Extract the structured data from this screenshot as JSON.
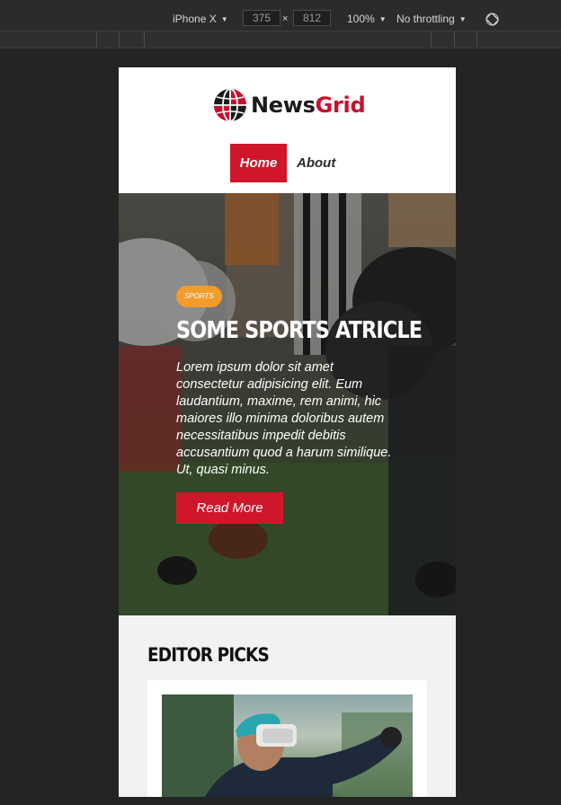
{
  "devtools": {
    "device": "iPhone X",
    "width": "375",
    "times": "×",
    "height": "812",
    "zoom": "100%",
    "throttle": "No throttling",
    "dropdown_caret": "▼"
  },
  "site": {
    "logo": {
      "news": "News",
      "grid": "Grid"
    },
    "nav": [
      {
        "label": "Home",
        "active": true
      },
      {
        "label": "About",
        "active": false
      }
    ],
    "hero": {
      "badge": "SPORTS",
      "title": "SOME SPORTS ATRICLE",
      "text": "Lorem ipsum dolor sit amet consectetur adipisicing elit. Eum laudantium, maxime, rem animi, hic maiores illo minima doloribus autem necessitatibus impedit debitis accusantium quod a harum similique. Ut, quasi minus.",
      "button": "Read More"
    },
    "editor_picks": {
      "title": "EDITOR PICKS"
    }
  },
  "colors": {
    "brand_red": "#d0162b",
    "badge_orange": "#f39c2c",
    "devtools_bg": "#242424"
  },
  "icons": [
    "globe-logo-icon",
    "rotate-device-icon",
    "dropdown-caret-icon"
  ]
}
